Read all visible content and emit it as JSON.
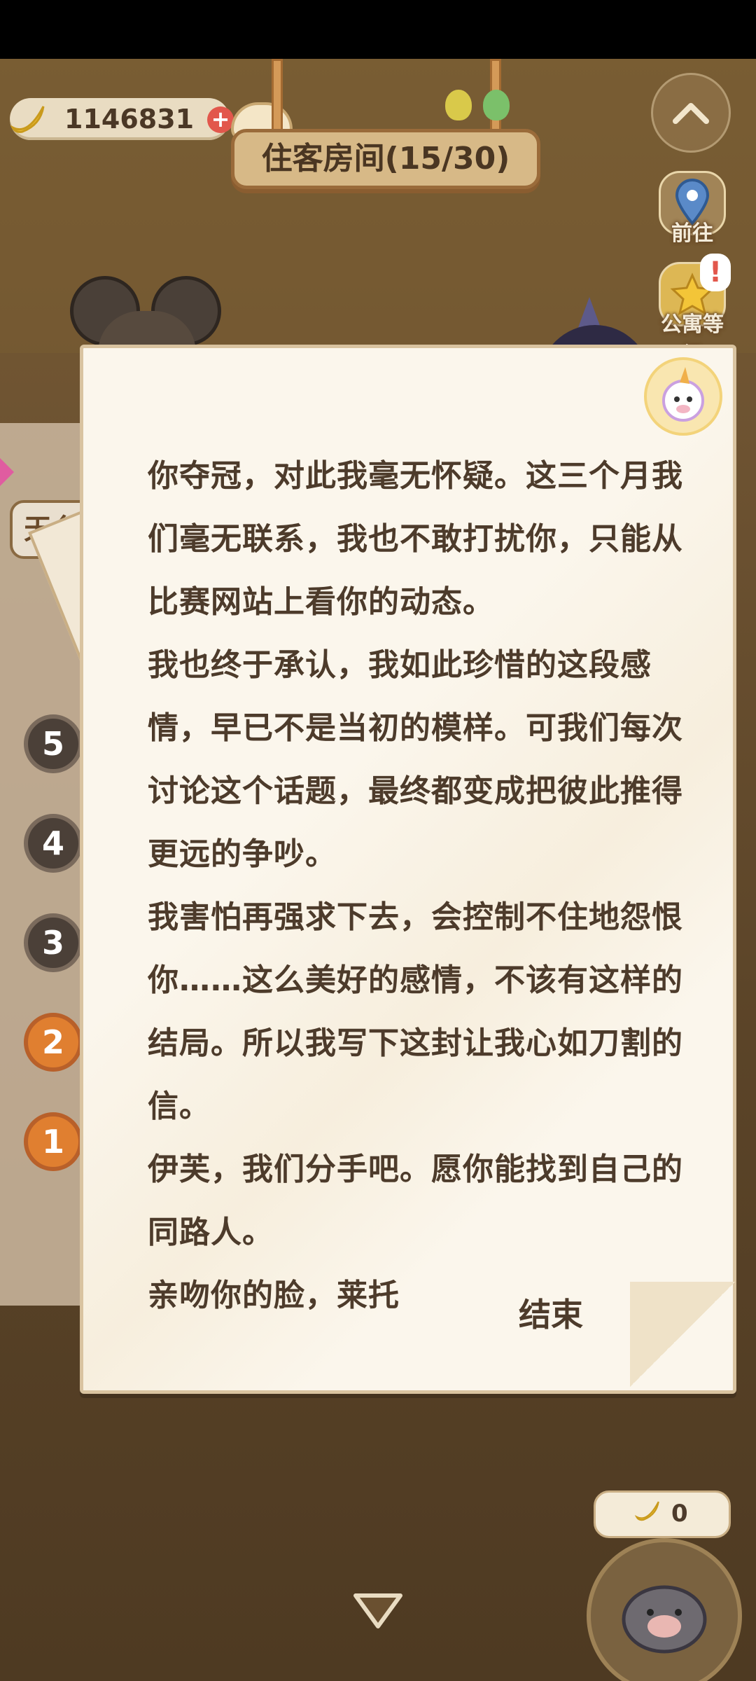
{
  "hud": {
    "banana_count": "1146831",
    "room_title": "住客房间(15/30)"
  },
  "side_buttons": {
    "goto_label": "前往",
    "apartment_level_label": "公寓等级",
    "alert_mark": "!"
  },
  "left": {
    "rooftop_tab": "天台",
    "floors": [
      "5",
      "4",
      "3",
      "2",
      "1"
    ]
  },
  "letter": {
    "paragraphs": [
      "你夺冠，对此我毫无怀疑。这三个月我们毫无联系，我也不敢打扰你，只能从比赛网站上看你的动态。",
      "我也终于承认，我如此珍惜的这段感情，早已不是当初的模样。可我们每次讨论这个话题，最终都变成把彼此推得更远的争吵。",
      "我害怕再强求下去，会控制不住地怨恨你……这么美好的感情，不该有这样的结局。所以我写下这封让我心如刀割的信。",
      "伊芙，我们分手吧。愿你能找到自己的同路人。",
      "亲吻你的脸，莱托"
    ],
    "end_button": "结束"
  },
  "bottom": {
    "tip_value": "0"
  },
  "icons": {
    "banana": "banana-icon",
    "plus": "plus-icon",
    "up": "chevron-up-icon",
    "map": "map-pin-icon",
    "level": "apartment-level-icon",
    "down": "triangle-down-icon",
    "pig": "pig-avatar-icon",
    "unicorn": "unicorn-avatar-icon"
  }
}
